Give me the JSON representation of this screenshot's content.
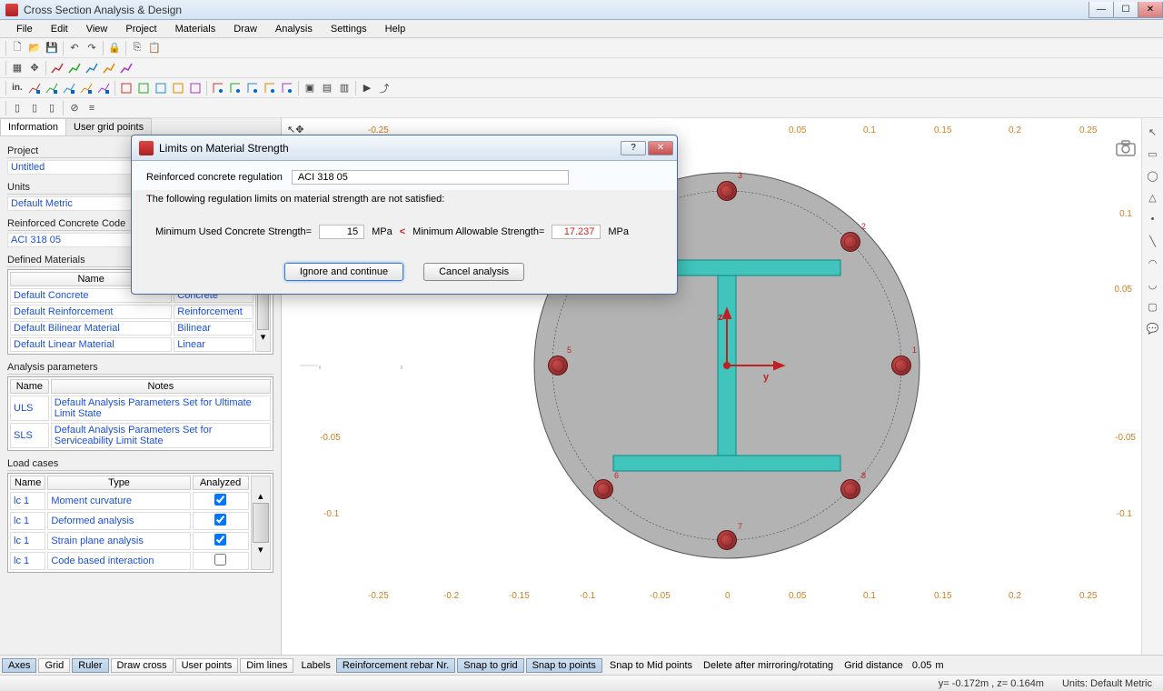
{
  "window": {
    "title": "Cross Section Analysis & Design"
  },
  "menu": [
    "File",
    "Edit",
    "View",
    "Project",
    "Materials",
    "Draw",
    "Analysis",
    "Settings",
    "Help"
  ],
  "tabs": {
    "info": "Information",
    "grid": "User grid points"
  },
  "project": {
    "label": "Project",
    "value": "Untitled"
  },
  "units": {
    "label": "Units",
    "value": "Default Metric"
  },
  "code": {
    "label": "Reinforced Concrete Code",
    "value": "ACI 318 05"
  },
  "materials": {
    "label": "Defined Materials",
    "headers": [
      "Name",
      "Type"
    ],
    "rows": [
      {
        "name": "Default Concrete",
        "type": "Concrete"
      },
      {
        "name": "Default Reinforcement",
        "type": "Reinforcement"
      },
      {
        "name": "Default Bilinear Material",
        "type": "Bilinear"
      },
      {
        "name": "Default Linear Material",
        "type": "Linear"
      }
    ]
  },
  "analysis_params": {
    "label": "Analysis parameters",
    "headers": [
      "Name",
      "Notes"
    ],
    "rows": [
      {
        "name": "ULS",
        "notes": "Default Analysis Parameters Set for Ultimate Limit State"
      },
      {
        "name": "SLS",
        "notes": "Default Analysis Parameters Set for Serviceability Limit State"
      }
    ]
  },
  "load_cases": {
    "label": "Load cases",
    "headers": [
      "Name",
      "Type",
      "Analyzed"
    ],
    "rows": [
      {
        "name": "lc 1",
        "type": "Moment curvature",
        "analyzed": true
      },
      {
        "name": "lc 1",
        "type": "Deformed analysis",
        "analyzed": true
      },
      {
        "name": "lc 1",
        "type": "Strain plane analysis",
        "analyzed": true
      },
      {
        "name": "lc 1",
        "type": "Code based interaction",
        "analyzed": false
      }
    ]
  },
  "opts": {
    "axes": "Axes",
    "grid": "Grid",
    "ruler": "Ruler",
    "drawcross": "Draw cross",
    "userpts": "User points",
    "dimlines": "Dim lines",
    "labels": "Labels",
    "rebar": "Reinforcement rebar Nr.",
    "snapgrid": "Snap to grid",
    "snappts": "Snap to points",
    "snapmid": "Snap to Mid points",
    "delmirror": "Delete after mirroring/rotating",
    "griddist": "Grid distance",
    "griddist_val": "0.05",
    "griddist_unit": "m"
  },
  "status": {
    "coords": "y= -0.172m , z= 0.164m",
    "units": "Units: Default Metric"
  },
  "axes": {
    "x": [
      "-0.25",
      "-0.2",
      "-0.15",
      "-0.1",
      "-0.05",
      "0",
      "0.05",
      "0.1",
      "0.15",
      "0.2",
      "0.25"
    ],
    "y_top": [
      "0.1",
      "0.05",
      "-0.05",
      "-0.1"
    ],
    "z_label": "z",
    "y_label": "y"
  },
  "dialog": {
    "title": "Limits on Material Strength",
    "reg_label": "Reinforced concrete regulation",
    "reg_value": "ACI 318 05",
    "message": "The following regulation limits on material strength are not satisfied:",
    "min_used_label": "Minimum Used Concrete Strength=",
    "min_used_value": "15",
    "mpa": "MPa",
    "lt": "<",
    "min_allow_label": "Minimum Allowable Strength=",
    "min_allow_value": "17.237",
    "ignore": "Ignore and continue",
    "cancel": "Cancel analysis"
  }
}
